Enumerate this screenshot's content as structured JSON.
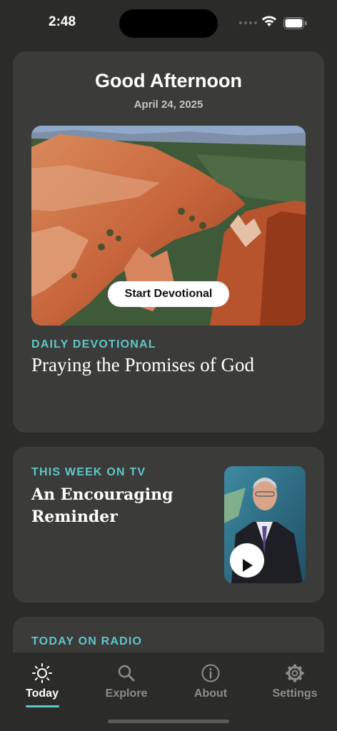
{
  "status_bar": {
    "time": "2:48"
  },
  "header": {
    "greeting": "Good Afternoon",
    "date": "April 24, 2025"
  },
  "devotional": {
    "button_label": "Start Devotional",
    "eyebrow": "DAILY DEVOTIONAL",
    "title": "Praying the Promises of God"
  },
  "tv": {
    "eyebrow": "THIS WEEK ON TV",
    "title": "An Encouraging Reminder"
  },
  "radio": {
    "eyebrow": "TODAY ON RADIO"
  },
  "tabs": [
    {
      "label": "Today",
      "icon": "sun-icon",
      "active": true
    },
    {
      "label": "Explore",
      "icon": "search-icon",
      "active": false
    },
    {
      "label": "About",
      "icon": "info-icon",
      "active": false
    },
    {
      "label": "Settings",
      "icon": "gear-icon",
      "active": false
    }
  ],
  "colors": {
    "accent": "#5fc7c9",
    "background": "#2b2b2a",
    "card": "#3b3b3a"
  }
}
